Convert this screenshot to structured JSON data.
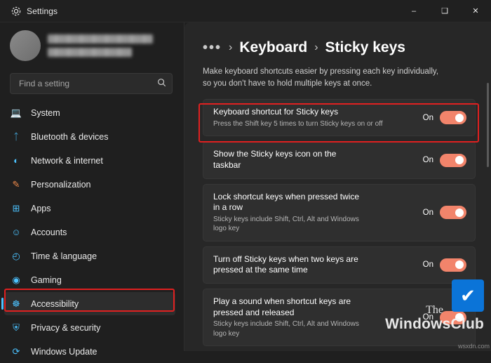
{
  "window": {
    "title": "Settings",
    "app_icon": "settings-gear-icon",
    "minimize": "–",
    "maximize": "❑",
    "close": "✕"
  },
  "account": {
    "name_blurred": "",
    "email_blurred": ""
  },
  "search": {
    "placeholder": "Find a setting",
    "icon": "search-icon",
    "value": ""
  },
  "sidebar": {
    "items": [
      {
        "label": "System",
        "icon": "💻",
        "color": "#4cc2ff",
        "selected": false
      },
      {
        "label": "Bluetooth & devices",
        "icon": "Ƀ",
        "color": "#4cc2ff",
        "selected": false
      },
      {
        "label": "Network & internet",
        "icon": "◔",
        "color": "#4cc2ff",
        "selected": false
      },
      {
        "label": "Personalization",
        "icon": "✎",
        "color": "#f08a4b",
        "selected": false
      },
      {
        "label": "Apps",
        "icon": "⊞",
        "color": "#4cc2ff",
        "selected": false
      },
      {
        "label": "Accounts",
        "icon": "☺",
        "color": "#4cc2ff",
        "selected": false
      },
      {
        "label": "Time & language",
        "icon": "◴",
        "color": "#4cc2ff",
        "selected": false
      },
      {
        "label": "Gaming",
        "icon": "◉",
        "color": "#4cc2ff",
        "selected": false
      },
      {
        "label": "Accessibility",
        "icon": "☸",
        "color": "#4cc2ff",
        "selected": true
      },
      {
        "label": "Privacy & security",
        "icon": "⛨",
        "color": "#4cc2ff",
        "selected": false
      },
      {
        "label": "Windows Update",
        "icon": "⟳",
        "color": "#4cc2ff",
        "selected": false
      }
    ]
  },
  "header": {
    "overflow": "•••",
    "chevron": "›",
    "crumb1": "Keyboard",
    "crumb2": "Sticky keys"
  },
  "page": {
    "description": "Make keyboard shortcuts easier by pressing each key individually, so you don't have to hold multiple keys at once."
  },
  "cards": [
    {
      "title": "Keyboard shortcut for Sticky keys",
      "subtitle": "Press the Shift key 5 times to turn Sticky keys on or off",
      "toggle_label": "On",
      "toggle_state": "on",
      "highlighted": true
    },
    {
      "title": "Show the Sticky keys icon on the taskbar",
      "subtitle": "",
      "toggle_label": "On",
      "toggle_state": "on",
      "highlighted": false
    },
    {
      "title": "Lock shortcut keys when pressed twice in a row",
      "subtitle": "Sticky keys include Shift, Ctrl, Alt and Windows logo key",
      "toggle_label": "On",
      "toggle_state": "on",
      "highlighted": false
    },
    {
      "title": "Turn off Sticky keys when two keys are pressed at the same time",
      "subtitle": "",
      "toggle_label": "On",
      "toggle_state": "on",
      "highlighted": false
    },
    {
      "title": "Play a sound when shortcut keys are pressed and released",
      "subtitle": "Sticky keys include Shift, Ctrl, Alt and Windows logo key",
      "toggle_label": "On",
      "toggle_state": "on",
      "highlighted": false
    }
  ],
  "watermark": {
    "line1": "The",
    "line2": "WindowsClub",
    "badge_icon": "✔",
    "corner": "wsxdn.com"
  },
  "colors": {
    "accent": "#4cc2ff",
    "toggle_on": "#f2846b",
    "highlight": "#e02020",
    "sidebar_bg": "#1f1f1f",
    "content_bg": "#272727",
    "card_bg": "#2f2f2f"
  }
}
